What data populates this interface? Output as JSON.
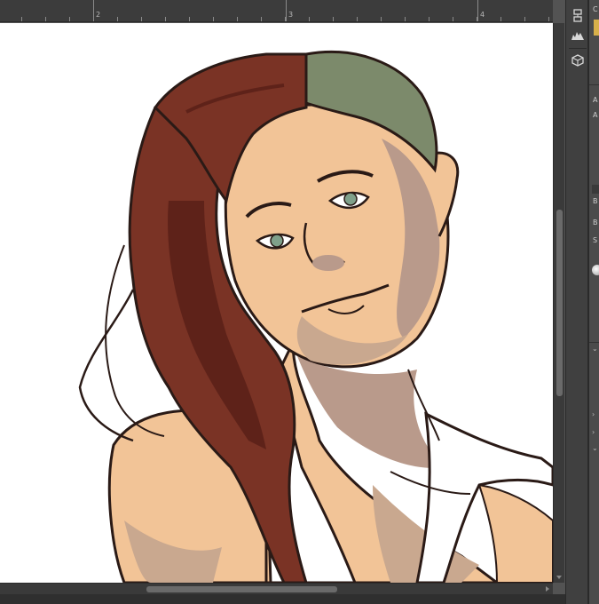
{
  "ruler": {
    "labels": [
      "2",
      "3",
      "4"
    ]
  },
  "artwork": {
    "description_colors": {
      "canvas": "#ffffff",
      "skin": "#f2c497",
      "skin_shadow": "#b99a8b",
      "hair": "#7a3325",
      "hair_dark": "#5e2219",
      "hair_green": "#7c8a6b",
      "lines": "#2a1a16",
      "eyes": "#7fa08a"
    }
  },
  "side_panel": {
    "labels": [
      "C",
      "A",
      "A",
      "B",
      "B",
      "S"
    ]
  },
  "colors": {
    "workspace": "#535353",
    "panel": "#404040",
    "scrollbar": "#3a3a3a",
    "accent_swatch": "#d8b04a"
  }
}
